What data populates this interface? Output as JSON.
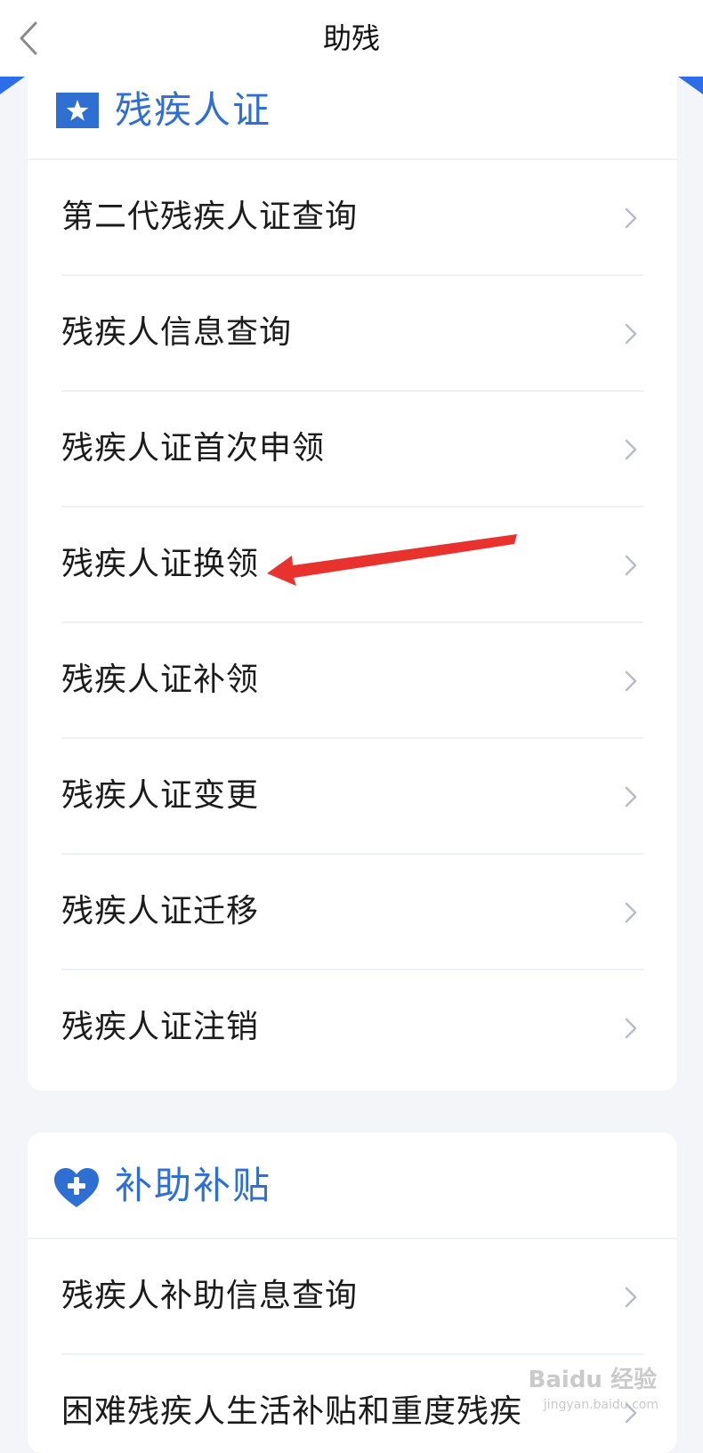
{
  "nav": {
    "title": "助残",
    "back_icon": "chevron-left-icon"
  },
  "colors": {
    "accent": "#2f6fd1",
    "arrow": "#e8322d",
    "background": "#f4f5f9"
  },
  "sections": [
    {
      "title": "残疾人证",
      "icon": "star-badge-icon",
      "items": [
        {
          "label": "第二代残疾人证查询"
        },
        {
          "label": "残疾人信息查询"
        },
        {
          "label": "残疾人证首次申领"
        },
        {
          "label": "残疾人证换领"
        },
        {
          "label": "残疾人证补领"
        },
        {
          "label": "残疾人证变更"
        },
        {
          "label": "残疾人证迁移"
        },
        {
          "label": "残疾人证注销"
        }
      ]
    },
    {
      "title": "补助补贴",
      "icon": "heart-plus-icon",
      "items": [
        {
          "label": "残疾人补助信息查询"
        },
        {
          "label": "困难残疾人生活补贴和重度残疾"
        }
      ]
    }
  ],
  "annotation": {
    "icon": "red-arrow-pointer"
  },
  "watermark": {
    "text": "Baidu 经验",
    "sub": "jingyan.baidu.com"
  }
}
